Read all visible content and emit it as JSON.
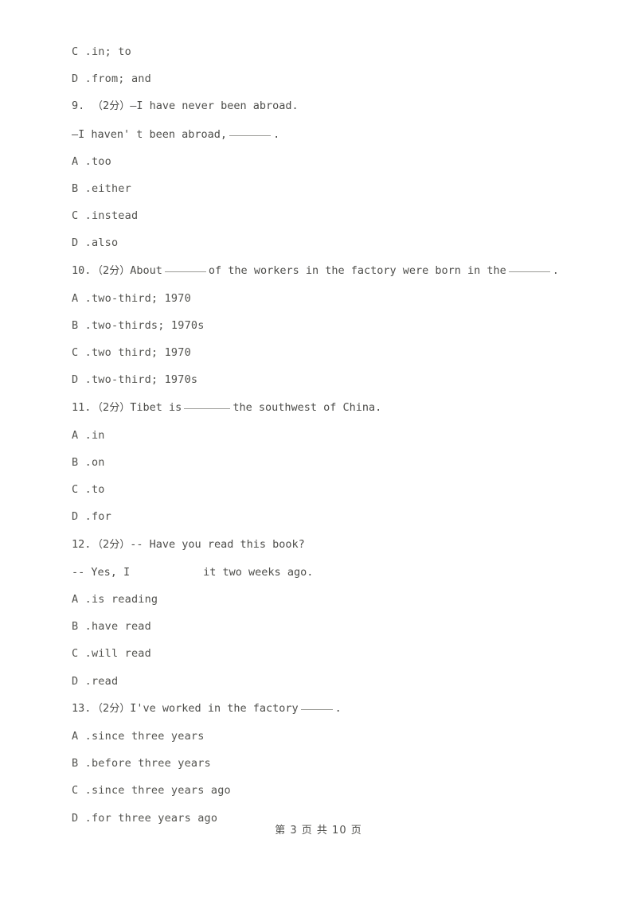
{
  "document": {
    "type": "exam-worksheet",
    "page_footer": "第 3 页 共 10 页",
    "text_color": "#4d4d4a",
    "blank_rule_color": "#9a9a96",
    "background": "#ffffff"
  },
  "carryover_options": [
    {
      "letter": "C .",
      "text": "in; to"
    },
    {
      "letter": "D .",
      "text": "from; and"
    }
  ],
  "questions": [
    {
      "number": "9.",
      "marks": "（2分）",
      "stem": "—I have never been abroad.",
      "stem_cont_pre": "—I haven' t been abroad,",
      "stem_cont_post": ".",
      "options": [
        {
          "letter": "A .",
          "text": "too"
        },
        {
          "letter": "B .",
          "text": "either"
        },
        {
          "letter": "C .",
          "text": "instead"
        },
        {
          "letter": "D .",
          "text": "also"
        }
      ]
    },
    {
      "number": "10.",
      "marks": "（2分）",
      "stem_a": "About",
      "stem_b": "of the workers in the factory were born in the",
      "stem_c": ".",
      "options": [
        {
          "letter": "A .",
          "text": "two-third; 1970"
        },
        {
          "letter": "B .",
          "text": "two-thirds; 1970s"
        },
        {
          "letter": "C .",
          "text": "two third; 1970"
        },
        {
          "letter": "D .",
          "text": "two-third; 1970s"
        }
      ]
    },
    {
      "number": "11.",
      "marks": "（2分）",
      "stem_a": "Tibet is",
      "stem_b": "the southwest of China.",
      "options": [
        {
          "letter": "A .",
          "text": "in"
        },
        {
          "letter": "B .",
          "text": "on"
        },
        {
          "letter": "C .",
          "text": "to"
        },
        {
          "letter": "D .",
          "text": "for"
        }
      ]
    },
    {
      "number": "12.",
      "marks": "（2分）",
      "stem": "-- Have you read this book?",
      "stem_cont_pre": "-- Yes, I",
      "stem_cont_post": "it two weeks ago.",
      "options": [
        {
          "letter": "A .",
          "text": "is reading"
        },
        {
          "letter": "B .",
          "text": "have read"
        },
        {
          "letter": "C .",
          "text": "will read"
        },
        {
          "letter": "D .",
          "text": "read"
        }
      ]
    },
    {
      "number": "13.",
      "marks": "（2分）",
      "stem_a": "I've worked in the factory",
      "stem_c": ".",
      "options": [
        {
          "letter": "A .",
          "text": "since three years"
        },
        {
          "letter": "B .",
          "text": "before three years"
        },
        {
          "letter": "C .",
          "text": "since three years ago"
        },
        {
          "letter": "D .",
          "text": "for three years ago"
        }
      ]
    }
  ]
}
